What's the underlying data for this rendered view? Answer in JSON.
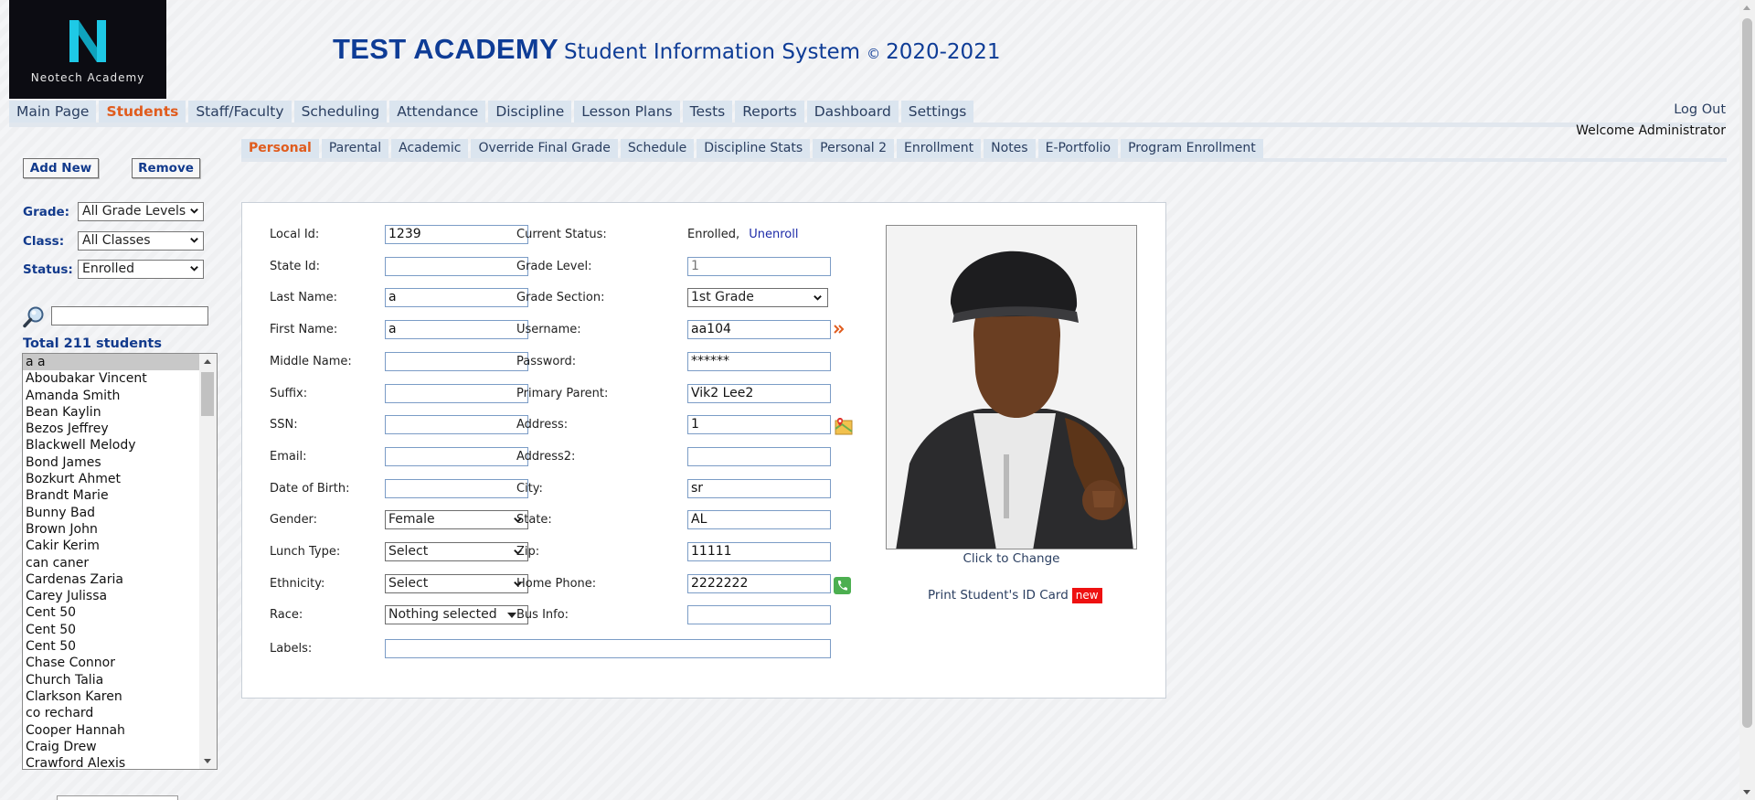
{
  "brand": {
    "logo_text": "Neotech Academy",
    "title": "TEST ACADEMY",
    "subtitle": "Student Information System",
    "copyright_symbol": "©",
    "year": "2020-2021",
    "title_color": "#0e3c96"
  },
  "main_nav": {
    "tabs": [
      "Main Page",
      "Students",
      "Staff/Faculty",
      "Scheduling",
      "Attendance",
      "Discipline",
      "Lesson Plans",
      "Tests",
      "Reports",
      "Dashboard",
      "Settings"
    ],
    "active": "Students",
    "logout": "Log Out",
    "welcome": "Welcome Administrator"
  },
  "sub_nav": {
    "tabs": [
      "Personal",
      "Parental",
      "Academic",
      "Override Final Grade",
      "Schedule",
      "Discipline Stats",
      "Personal 2",
      "Enrollment",
      "Notes",
      "E-Portfolio",
      "Program Enrollment"
    ],
    "active": "Personal"
  },
  "sidebar": {
    "add_new": "Add New",
    "remove": "Remove",
    "filters": {
      "grade_label": "Grade:",
      "grade_value": "All Grade Levels",
      "class_label": "Class:",
      "class_value": "All Classes",
      "status_label": "Status:",
      "status_value": "Enrolled"
    },
    "search_value": "",
    "total": "Total 211 students",
    "students": [
      "a a",
      "Aboubakar Vincent",
      "Amanda Smith",
      "Bean Kaylin",
      "Bezos Jeffrey",
      "Blackwell Melody",
      "Bond James",
      "Bozkurt Ahmet",
      "Brandt Marie",
      "Bunny Bad",
      "Brown John",
      "Cakir Kerim",
      "can caner",
      "Cardenas Zaria",
      "Carey Julissa",
      "Cent 50",
      "Cent 50",
      "Cent 50",
      "Chase Connor",
      "Church Talia",
      "Clarkson Karen",
      "co rechard",
      "Cooper Hannah",
      "Craig Drew",
      "Crawford Alexis"
    ],
    "selected_index": 0
  },
  "form": {
    "left": [
      {
        "label": "Local Id:",
        "value": "1239",
        "type": "input"
      },
      {
        "label": "State Id:",
        "value": "",
        "type": "input"
      },
      {
        "label": "Last Name:",
        "value": "a",
        "type": "input"
      },
      {
        "label": "First Name:",
        "value": "a",
        "type": "input"
      },
      {
        "label": "Middle Name:",
        "value": "",
        "type": "input"
      },
      {
        "label": "Suffix:",
        "value": "",
        "type": "input"
      },
      {
        "label": "SSN:",
        "value": "",
        "type": "input"
      },
      {
        "label": "Email:",
        "value": "",
        "type": "input"
      },
      {
        "label": "Date of Birth:",
        "value": "",
        "type": "input"
      },
      {
        "label": "Gender:",
        "value": "Female",
        "type": "select"
      },
      {
        "label": "Lunch Type:",
        "value": "Select",
        "type": "select"
      },
      {
        "label": "Ethnicity:",
        "value": "Select",
        "type": "select"
      },
      {
        "label": "Race:",
        "value": "Nothing selected",
        "type": "multiselect"
      }
    ],
    "right": [
      {
        "label": "Current Status:",
        "value": "Enrolled,",
        "link": "Unenroll",
        "type": "text"
      },
      {
        "label": "Grade Level:",
        "value": "1",
        "type": "input-disabled"
      },
      {
        "label": "Grade Section:",
        "value": "1st Grade",
        "type": "select"
      },
      {
        "label": "Username:",
        "value": "aa104",
        "type": "input"
      },
      {
        "label": "Password:",
        "value": "******",
        "type": "input"
      },
      {
        "label": "Primary Parent:",
        "value": "Vik2 Lee2",
        "type": "input"
      },
      {
        "label": "Address:",
        "value": "1",
        "type": "input"
      },
      {
        "label": "Address2:",
        "value": "",
        "type": "input"
      },
      {
        "label": "City:",
        "value": "sr",
        "type": "input"
      },
      {
        "label": "State:",
        "value": "AL",
        "type": "input"
      },
      {
        "label": "Zip:",
        "value": "11111",
        "type": "input"
      },
      {
        "label": "Home Phone:",
        "value": "2222222",
        "type": "input"
      },
      {
        "label": "Bus Info:",
        "value": "",
        "type": "input"
      }
    ],
    "labels_label": "Labels:",
    "labels_value": ""
  },
  "photo": {
    "caption": "Click to Change",
    "print_id": "Print Student's ID Card",
    "new_badge": "new"
  },
  "icons": {
    "username_action": "double-chevron-icon",
    "address_map": "map-pin-icon",
    "phone": "phone-icon",
    "search": "magnifier-icon"
  },
  "colors": {
    "accent": "#e05c1e",
    "nav_bg": "#dbe5ef",
    "label_blue": "#123a8c",
    "new_badge": "#ee1111"
  }
}
